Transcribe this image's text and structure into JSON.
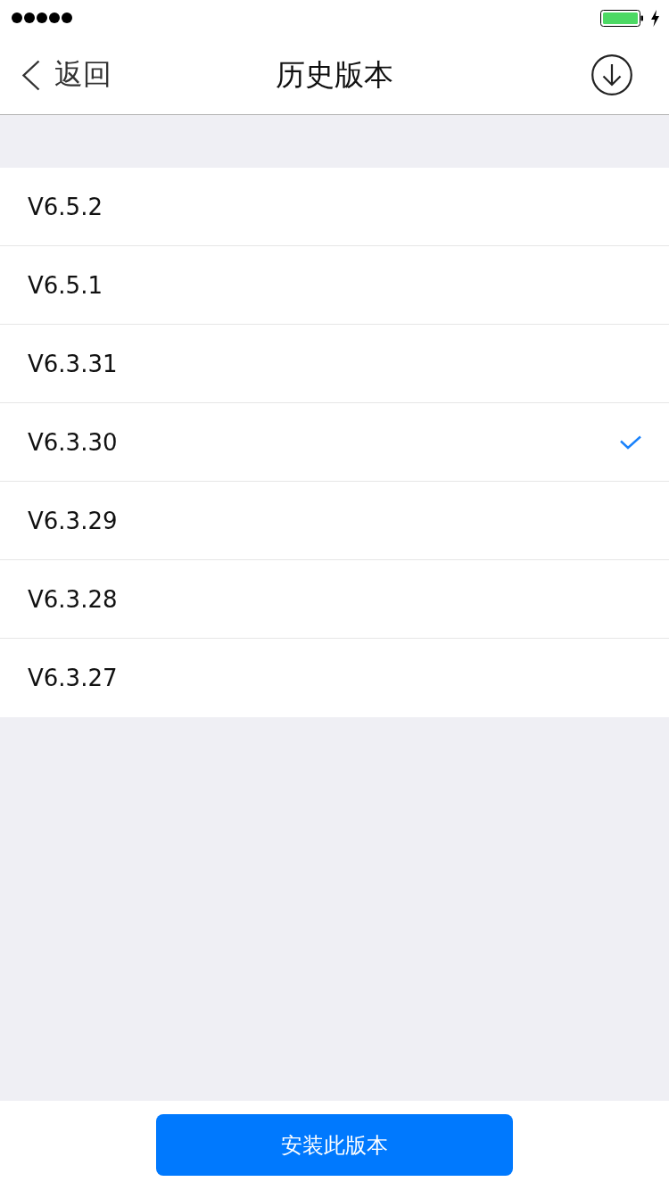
{
  "status_bar": {
    "battery": {
      "charging": true
    }
  },
  "nav_bar": {
    "back_label": "返回",
    "title": "历史版本"
  },
  "versions": [
    {
      "label": "V6.5.2",
      "selected": false
    },
    {
      "label": "V6.5.1",
      "selected": false
    },
    {
      "label": "V6.3.31",
      "selected": false
    },
    {
      "label": "V6.3.30",
      "selected": true
    },
    {
      "label": "V6.3.29",
      "selected": false
    },
    {
      "label": "V6.3.28",
      "selected": false
    },
    {
      "label": "V6.3.27",
      "selected": false
    }
  ],
  "install_button": {
    "label": "安装此版本"
  }
}
